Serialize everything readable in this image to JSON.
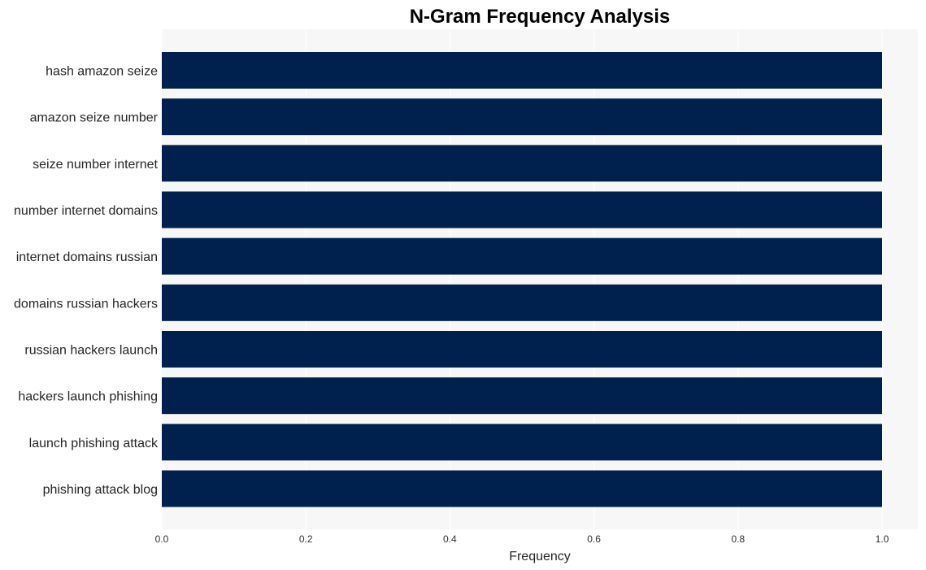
{
  "chart_data": {
    "type": "bar",
    "orientation": "horizontal",
    "title": "N-Gram Frequency Analysis",
    "xlabel": "Frequency",
    "ylabel": "",
    "categories": [
      "hash amazon seize",
      "amazon seize number",
      "seize number internet",
      "number internet domains",
      "internet domains russian",
      "domains russian hackers",
      "russian hackers launch",
      "hackers launch phishing",
      "launch phishing attack",
      "phishing attack blog"
    ],
    "values": [
      1,
      1,
      1,
      1,
      1,
      1,
      1,
      1,
      1,
      1
    ],
    "xlim": [
      0,
      1.05
    ],
    "xticks": [
      "0.0",
      "0.2",
      "0.4",
      "0.6",
      "0.8",
      "1.0"
    ],
    "xtick_values": [
      0,
      0.2,
      0.4,
      0.6,
      0.8,
      1.0
    ],
    "grid": true,
    "legend": "none",
    "colors": {
      "bar": "#00214d",
      "plot_background": "#f7f7f7",
      "grid": "#ffffff"
    }
  }
}
